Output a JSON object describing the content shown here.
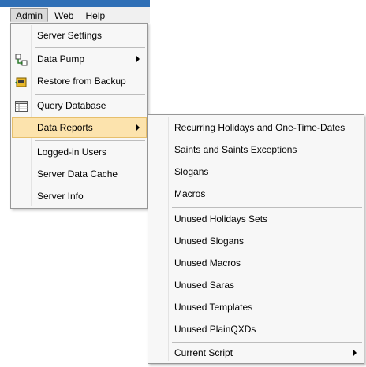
{
  "menubar": {
    "items": [
      "Admin",
      "Web",
      "Help"
    ]
  },
  "admin_menu": {
    "server_settings": "Server Settings",
    "data_pump": "Data Pump",
    "restore_from_backup": "Restore from Backup",
    "query_database": "Query Database",
    "data_reports": "Data Reports",
    "logged_in_users": "Logged-in Users",
    "server_data_cache": "Server Data Cache",
    "server_info": "Server Info"
  },
  "reports_menu": {
    "recurring_holidays": "Recurring Holidays and One-Time-Dates",
    "saints": "Saints and Saints Exceptions",
    "slogans": "Slogans",
    "macros": "Macros",
    "unused_holidays_sets": "Unused Holidays Sets",
    "unused_slogans": "Unused Slogans",
    "unused_macros": "Unused Macros",
    "unused_saras": "Unused Saras",
    "unused_templates": "Unused Templates",
    "unused_plainqxds": "Unused PlainQXDs",
    "current_script": "Current Script"
  },
  "colors": {
    "highlight": "#fce3ad",
    "highlight_border": "#e6bf6c",
    "title_blue": "#2f6fb6"
  }
}
